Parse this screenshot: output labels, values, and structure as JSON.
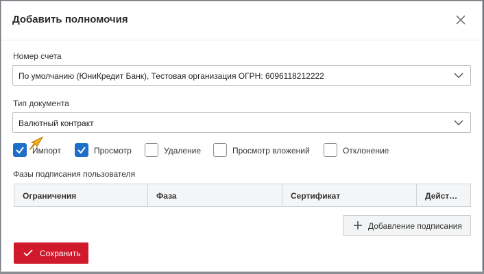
{
  "dialog": {
    "title": "Добавить полномочия"
  },
  "account": {
    "label": "Номер счета",
    "value": "По умолчанию (ЮниКредит Банк), Тестовая организация ОГРН: 6096118212222"
  },
  "doc_type": {
    "label": "Тип документа",
    "value": "Валютный контракт"
  },
  "permissions": [
    {
      "label": "Импорт",
      "checked": true
    },
    {
      "label": "Просмотр",
      "checked": true
    },
    {
      "label": "Удаление",
      "checked": false
    },
    {
      "label": "Просмотр вложений",
      "checked": false
    },
    {
      "label": "Отклонение",
      "checked": false
    }
  ],
  "phases": {
    "label": "Фазы подписания пользователя",
    "columns": [
      "Ограничения",
      "Фаза",
      "Сертификат",
      "Дейст…"
    ]
  },
  "actions": {
    "add_signing": "Добавление подписания",
    "save": "Сохранить"
  },
  "colors": {
    "accent": "#1e6fc7",
    "primary_button": "#d0192b",
    "cursor": "#f2b01e"
  }
}
